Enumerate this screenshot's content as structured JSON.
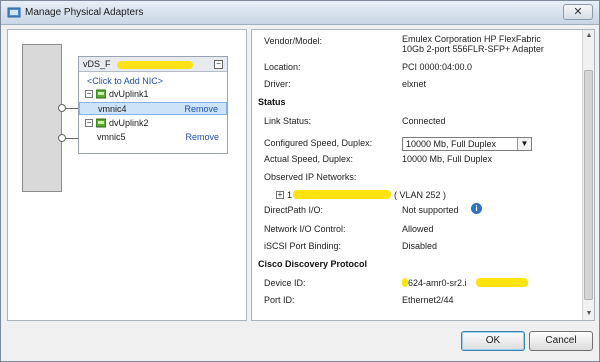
{
  "window": {
    "title": "Manage Physical Adapters",
    "close_glyph": "✕"
  },
  "switch": {
    "name": "vDS_F",
    "add_nic": "<Click to Add NIC>",
    "uplinks": [
      {
        "label": "dvUplink1",
        "nic": "vmnic4",
        "remove": "Remove",
        "selected": true
      },
      {
        "label": "dvUplink2",
        "nic": "vmnic5",
        "remove": "Remove",
        "selected": false
      }
    ]
  },
  "props": {
    "vendor_label": "Vendor/Model:",
    "vendor_value": "Emulex Corporation HP FlexFabric 10Gb 2-port 556FLR-SFP+ Adapter",
    "vendor_value_line1": "Emulex Corporation HP FlexFabric",
    "vendor_value_line2": "10Gb 2-port 556FLR-SFP+ Adapter",
    "location_label": "Location:",
    "location_value": "PCI 0000:04:00.0",
    "driver_label": "Driver:",
    "driver_value": "elxnet",
    "status_section": "Status",
    "link_label": "Link Status:",
    "link_value": "Connected",
    "conf_speed_label": "Configured Speed, Duplex:",
    "conf_speed_value": "10000 Mb, Full Duplex",
    "actual_speed_label": "Actual Speed, Duplex:",
    "actual_speed_value": "10000 Mb, Full Duplex",
    "observed_label": "Observed IP Networks:",
    "observed_prefix": "1",
    "observed_vlan": "( VLAN 252 )",
    "directpath_label": "DirectPath I/O:",
    "directpath_value": "Not supported",
    "netio_label": "Network I/O Control:",
    "netio_value": "Allowed",
    "iscsi_label": "iSCSI Port Binding:",
    "iscsi_value": "Disabled",
    "cdp_section": "Cisco Discovery Protocol",
    "device_label": "Device ID:",
    "device_value": "624-amr0-sr2.i",
    "port_label": "Port ID:",
    "port_value": "Ethernet2/44"
  },
  "buttons": {
    "ok": "OK",
    "cancel": "Cancel"
  },
  "icons": {
    "app": "vsphere-network-icon",
    "info": "info-icon",
    "uplink": "uplink-adapter-icon",
    "collapse": "collapse-minus-icon"
  },
  "colors": {
    "selection": "#cde3f8",
    "link": "#1f4fb0",
    "redaction": "#ffe100",
    "info": "#2f6fc4"
  }
}
